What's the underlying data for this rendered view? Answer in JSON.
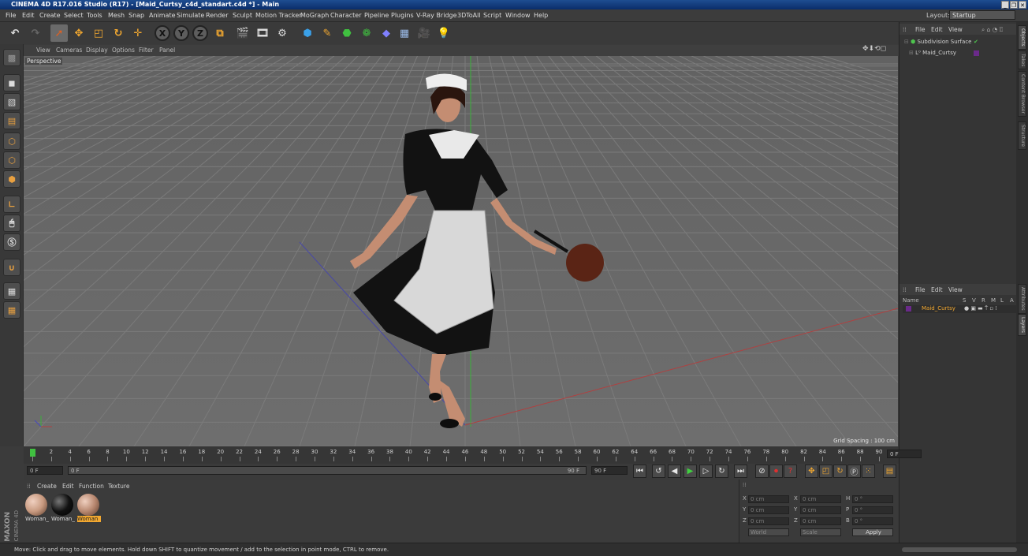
{
  "window": {
    "title": "CINEMA 4D R17.016 Studio (R17) - [Maid_Curtsy_c4d_standart.c4d *] - Main"
  },
  "menu": [
    "File",
    "Edit",
    "Create",
    "Select",
    "Tools",
    "Mesh",
    "Snap",
    "Animate",
    "Simulate",
    "Render",
    "Sculpt",
    "Motion Tracker",
    "MoGraph",
    "Character",
    "Pipeline",
    "Plugins",
    "V-Ray Bridge",
    "3DToAll",
    "Script",
    "Window",
    "Help"
  ],
  "layout": {
    "label": "Layout:",
    "value": "Startup"
  },
  "viewport": {
    "menu": [
      "View",
      "Cameras",
      "Display",
      "Options",
      "Filter",
      "Panel"
    ],
    "camera_label": "Perspective",
    "grid_spacing": "Grid Spacing : 100 cm"
  },
  "objects_panel": {
    "menu": [
      "File",
      "Edit",
      "View"
    ],
    "items": [
      "Subdivision Surface",
      "Maid_Curtsy"
    ]
  },
  "layers_panel": {
    "menu": [
      "File",
      "Edit",
      "View"
    ],
    "header": {
      "name": "Name",
      "cols": [
        "S",
        "V",
        "R",
        "M",
        "L",
        "A"
      ]
    },
    "items": [
      "Maid_Curtsy"
    ]
  },
  "side_tabs": [
    "Objects",
    "Takes",
    "Content Browser",
    "Structure"
  ],
  "side_tabs_lower": [
    "Attributes",
    "Layers"
  ],
  "timeline": {
    "ticks": [
      "0",
      "2",
      "4",
      "6",
      "8",
      "10",
      "12",
      "14",
      "16",
      "18",
      "20",
      "22",
      "24",
      "26",
      "28",
      "30",
      "32",
      "34",
      "36",
      "38",
      "40",
      "42",
      "44",
      "46",
      "48",
      "50",
      "52",
      "54",
      "56",
      "58",
      "60",
      "62",
      "64",
      "66",
      "68",
      "70",
      "72",
      "74",
      "76",
      "78",
      "80",
      "82",
      "84",
      "86",
      "88",
      "90"
    ],
    "current_frame": "0 F"
  },
  "transport": {
    "start": "0 F",
    "slider_start": "0 F",
    "slider_end": "90 F",
    "end": "90 F"
  },
  "materials": {
    "menu": [
      "Create",
      "Edit",
      "Function",
      "Texture"
    ],
    "items": [
      {
        "label": "Woman_",
        "color": "#c89a80"
      },
      {
        "label": "Woman_",
        "color": "#111111"
      },
      {
        "label": "Woman",
        "color": "#b88870"
      }
    ]
  },
  "coords": {
    "rows": [
      {
        "a": "X",
        "av": "0 cm",
        "b": "X",
        "bv": "0 cm",
        "c": "H",
        "cv": "0 °"
      },
      {
        "a": "Y",
        "av": "0 cm",
        "b": "Y",
        "bv": "0 cm",
        "c": "P",
        "cv": "0 °"
      },
      {
        "a": "Z",
        "av": "0 cm",
        "b": "Z",
        "bv": "0 cm",
        "c": "B",
        "cv": "0 °"
      }
    ],
    "mode1": "World",
    "mode2": "Scale",
    "apply": "Apply"
  },
  "brand": {
    "maxon": "MAXON",
    "product": "CINEMA 4D"
  },
  "status": "Move: Click and drag to move elements. Hold down SHIFT to quantize movement / add to the selection in point mode, CTRL to remove."
}
